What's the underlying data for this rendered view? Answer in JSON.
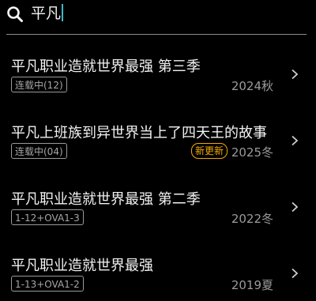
{
  "search": {
    "query": "平凡",
    "icon": "search-icon"
  },
  "colors": {
    "background": "#000000",
    "cursor": "#3fb7c8",
    "new_tag": "#f2a900"
  },
  "results": [
    {
      "title": "平凡职业造就世界最强 第三季",
      "badge": "连载中(12)",
      "new_tag": "",
      "season": "2024秋"
    },
    {
      "title": "平凡上班族到异世界当上了四天王的故事",
      "badge": "连载中(04)",
      "new_tag": "新更新",
      "season": "2025冬"
    },
    {
      "title": "平凡职业造就世界最强 第二季",
      "badge": "1-12+OVA1-3",
      "new_tag": "",
      "season": "2022冬"
    },
    {
      "title": "平凡职业造就世界最强",
      "badge": "1-13+OVA1-2",
      "new_tag": "",
      "season": "2019夏"
    }
  ]
}
